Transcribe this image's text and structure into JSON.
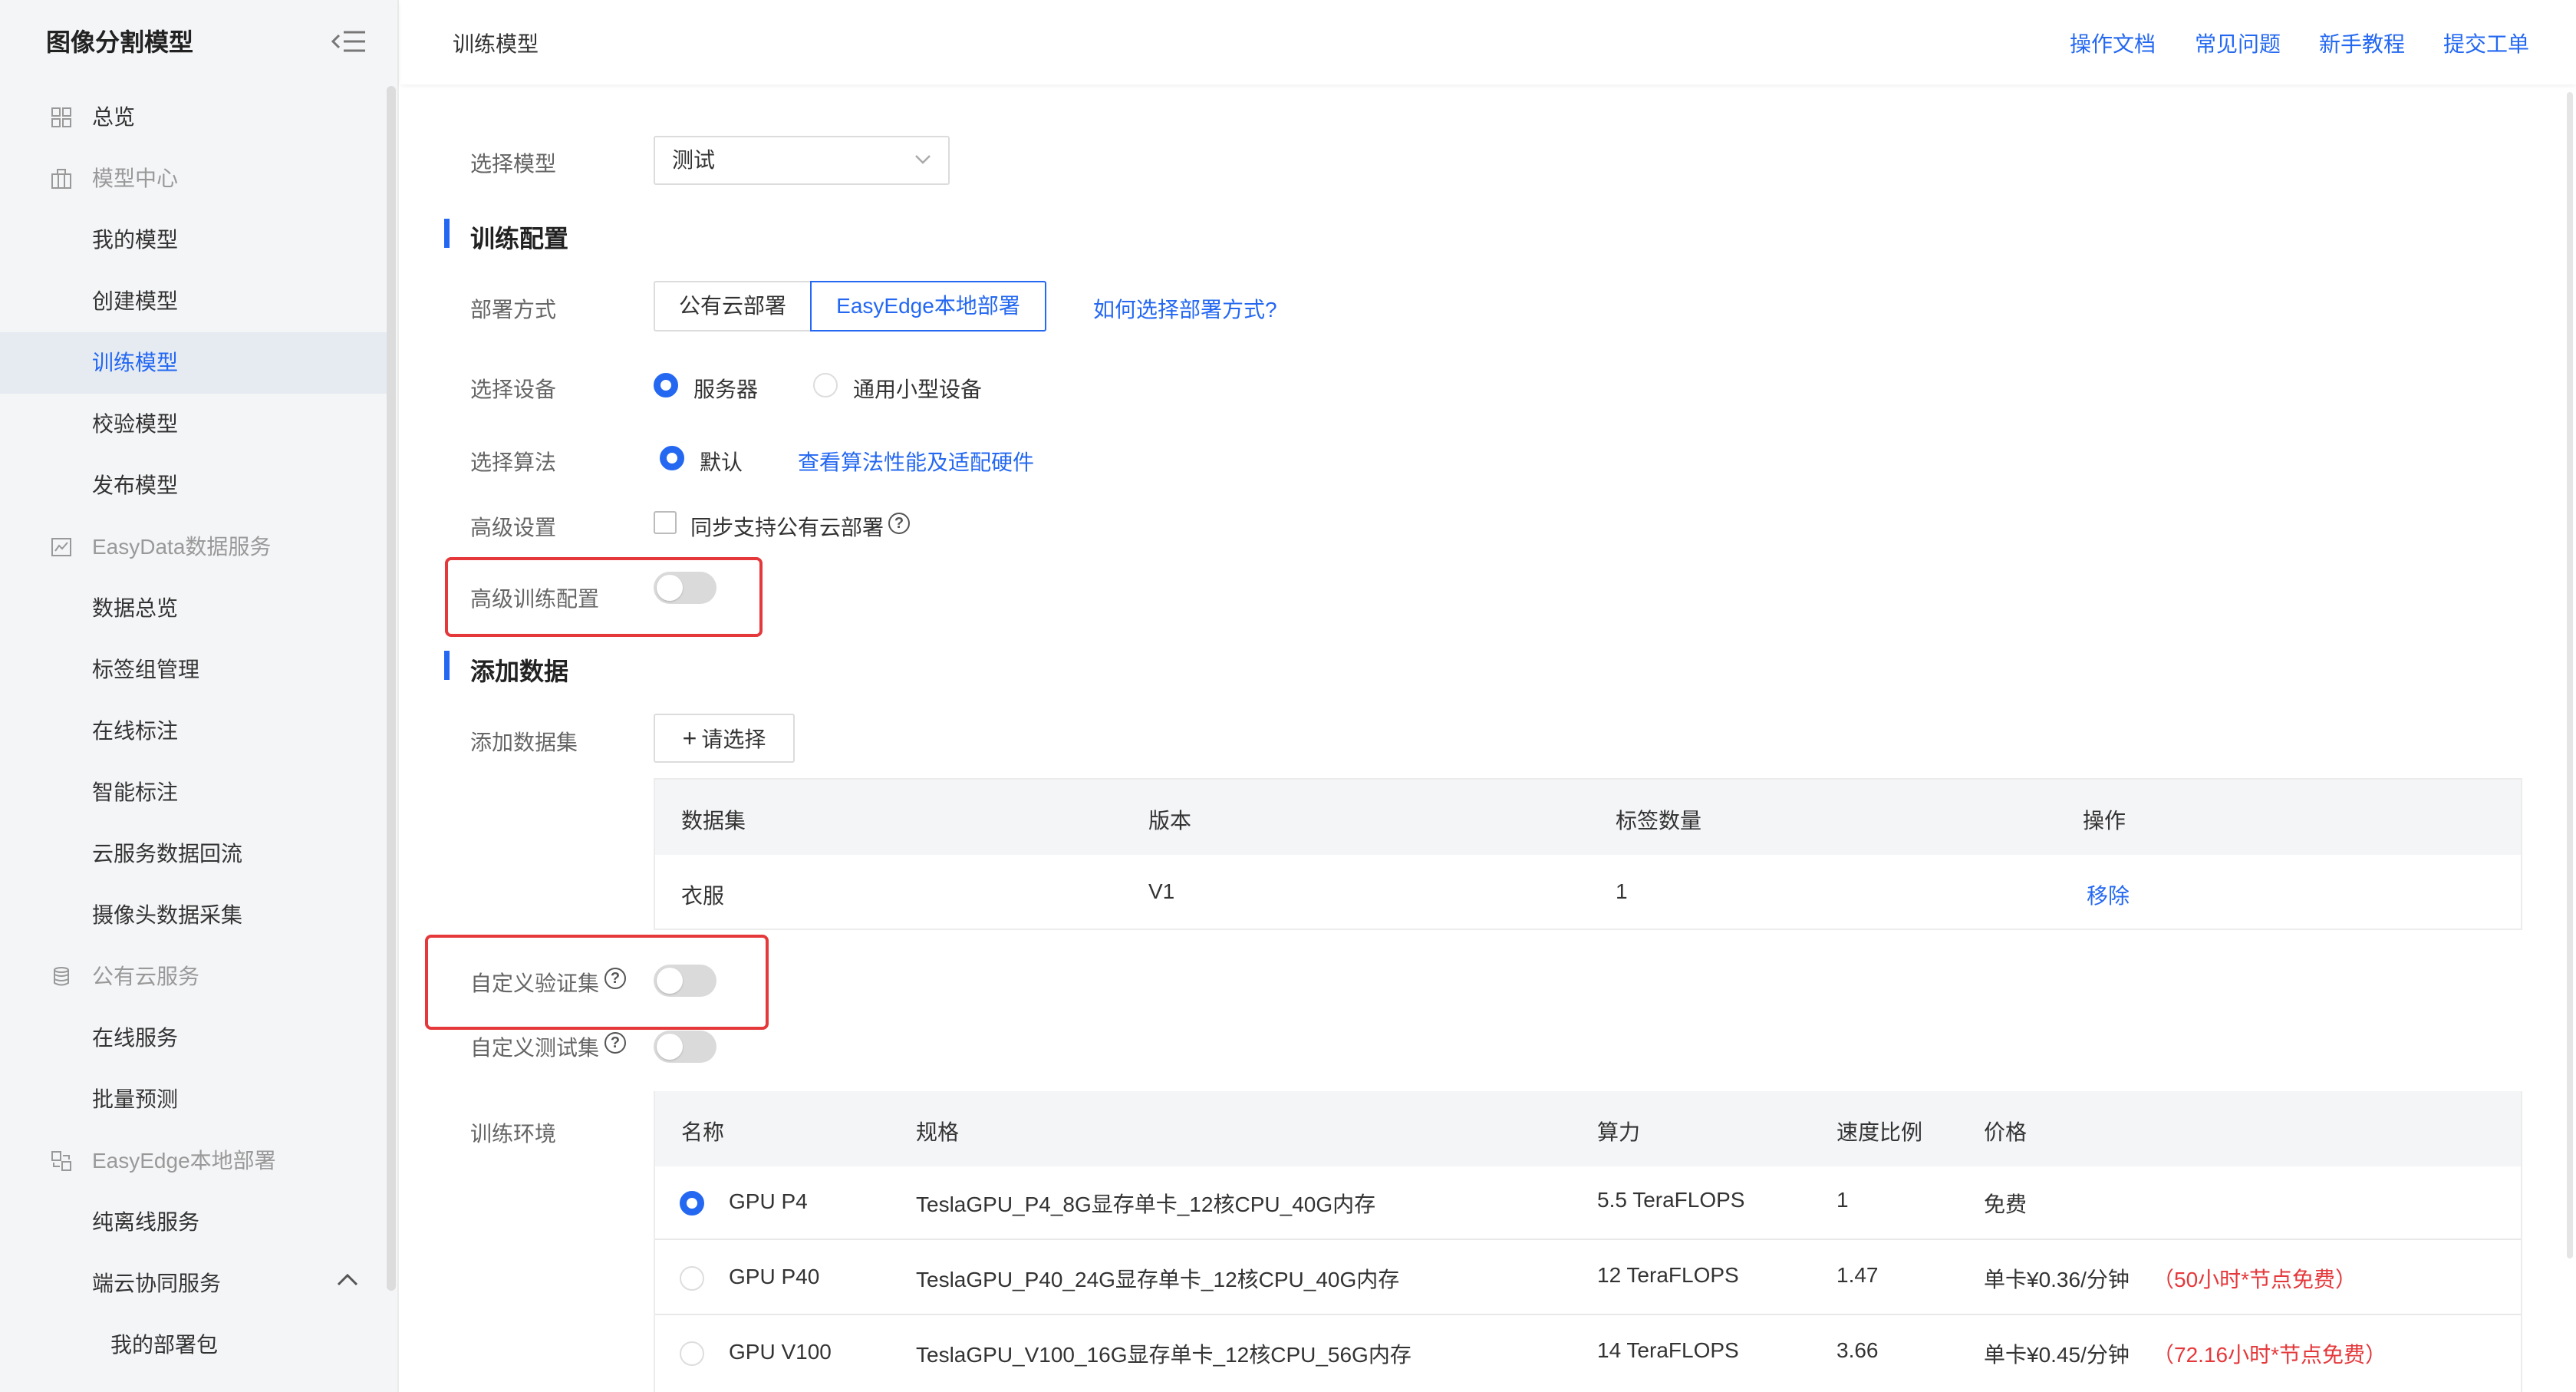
{
  "app_title": "图像分割模型",
  "sidebar": {
    "items": [
      {
        "label": "总览",
        "type": "group",
        "icon": "dashboard-icon"
      },
      {
        "label": "模型中心",
        "type": "group",
        "icon": "model-center-icon"
      },
      {
        "label": "我的模型",
        "type": "item"
      },
      {
        "label": "创建模型",
        "type": "item"
      },
      {
        "label": "训练模型",
        "type": "item",
        "active": true
      },
      {
        "label": "校验模型",
        "type": "item"
      },
      {
        "label": "发布模型",
        "type": "item"
      },
      {
        "label": "EasyData数据服务",
        "type": "group",
        "icon": "chart-icon"
      },
      {
        "label": "数据总览",
        "type": "item"
      },
      {
        "label": "标签组管理",
        "type": "item"
      },
      {
        "label": "在线标注",
        "type": "item"
      },
      {
        "label": "智能标注",
        "type": "item"
      },
      {
        "label": "云服务数据回流",
        "type": "item"
      },
      {
        "label": "摄像头数据采集",
        "type": "item"
      },
      {
        "label": "公有云服务",
        "type": "group",
        "icon": "cloud-service-icon"
      },
      {
        "label": "在线服务",
        "type": "item"
      },
      {
        "label": "批量预测",
        "type": "item"
      },
      {
        "label": "EasyEdge本地部署",
        "type": "group",
        "icon": "edge-deploy-icon"
      },
      {
        "label": "纯离线服务",
        "type": "item"
      },
      {
        "label": "端云协同服务",
        "type": "item"
      },
      {
        "label": "我的部署包",
        "type": "subitem"
      }
    ]
  },
  "header": {
    "breadcrumb": "训练模型",
    "links": [
      "操作文档",
      "常见问题",
      "新手教程",
      "提交工单"
    ]
  },
  "form": {
    "select_model_label": "选择模型",
    "select_model_value": "测试",
    "train_config_title": "训练配置",
    "deploy_label": "部署方式",
    "deploy_options": [
      "公有云部署",
      "EasyEdge本地部署"
    ],
    "deploy_selected": "EasyEdge本地部署",
    "deploy_help_link": "如何选择部署方式?",
    "device_label": "选择设备",
    "device_options": [
      "服务器",
      "通用小型设备"
    ],
    "device_selected": "服务器",
    "algo_label": "选择算法",
    "algo_option": "默认",
    "algo_link": "查看算法性能及适配硬件",
    "advanced_label": "高级设置",
    "advanced_checkbox": "同步支持公有云部署",
    "advanced_train_label": "高级训练配置",
    "add_data_title": "添加数据",
    "add_dataset_label": "添加数据集",
    "add_dataset_button": "请选择",
    "custom_val_label": "自定义验证集",
    "custom_test_label": "自定义测试集",
    "env_label": "训练环境"
  },
  "dataset_table": {
    "headers": [
      "数据集",
      "版本",
      "标签数量",
      "操作"
    ],
    "rows": [
      {
        "dataset": "衣服",
        "version": "V1",
        "labels": "1",
        "action": "移除"
      }
    ]
  },
  "env_table": {
    "headers": [
      "名称",
      "规格",
      "算力",
      "速度比例",
      "价格"
    ],
    "rows": [
      {
        "name": "GPU P4",
        "spec": "TeslaGPU_P4_8G显存单卡_12核CPU_40G内存",
        "power": "5.5 TeraFLOPS",
        "speed": "1",
        "price": "免费",
        "note": "",
        "selected": true
      },
      {
        "name": "GPU P40",
        "spec": "TeslaGPU_P40_24G显存单卡_12核CPU_40G内存",
        "power": "12 TeraFLOPS",
        "speed": "1.47",
        "price": "单卡¥0.36/分钟",
        "note": "（50小时*节点免费）",
        "selected": false
      },
      {
        "name": "GPU V100",
        "spec": "TeslaGPU_V100_16G显存单卡_12核CPU_56G内存",
        "power": "14 TeraFLOPS",
        "speed": "3.66",
        "price": "单卡¥0.45/分钟",
        "note": "（72.16小时*节点免费）",
        "selected": false
      }
    ]
  },
  "colors": {
    "accent": "#2468f2",
    "highlight_box": "#e5383b",
    "free_note": "#e5383b"
  }
}
